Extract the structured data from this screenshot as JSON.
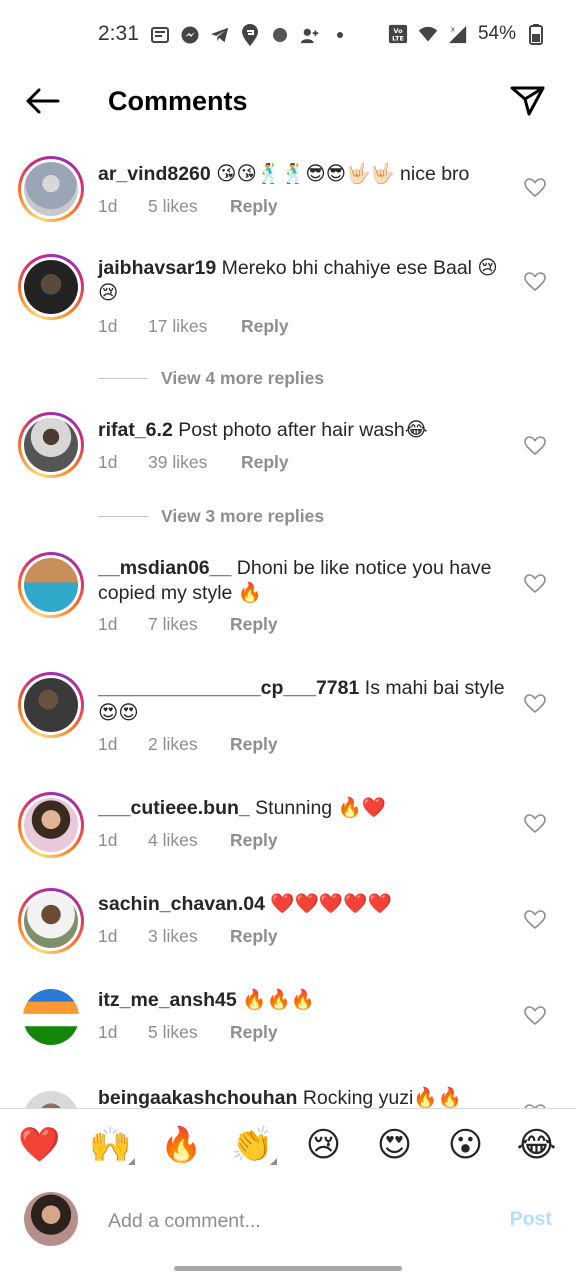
{
  "status_bar": {
    "time": "2:31",
    "network": "VoLTE",
    "battery": "54%"
  },
  "header": {
    "title": "Comments",
    "back_icon": "arrow-left-icon",
    "send_icon": "paper-plane-icon"
  },
  "comments": [
    {
      "username": "ar_vind8260",
      "text": "😘😘🕺🕺😎😎🤟🏻🤟🏻 nice bro",
      "time": "1d",
      "likes": "5 likes",
      "reply": "Reply"
    },
    {
      "username": "jaibhavsar19",
      "text": "Mereko bhi chahiye ese Baal 😢😢",
      "time": "1d",
      "likes": "17 likes",
      "reply": "Reply",
      "more_replies": "View 4 more replies"
    },
    {
      "username": "rifat_6.2",
      "text": "Post photo after hair wash😂",
      "time": "1d",
      "likes": "39 likes",
      "reply": "Reply",
      "more_replies": "View 3 more replies"
    },
    {
      "username": "__msdian06__",
      "text": "Dhoni be like notice you have copied my style 🔥",
      "time": "1d",
      "likes": "7 likes",
      "reply": "Reply"
    },
    {
      "username": "_______________cp___7781",
      "text": "Is mahi bai style 😍😍",
      "time": "1d",
      "likes": "2 likes",
      "reply": "Reply"
    },
    {
      "username": "___cutieee.bun_",
      "text": "Stunning 🔥❤️",
      "time": "1d",
      "likes": "4 likes",
      "reply": "Reply"
    },
    {
      "username": "sachin_chavan.04",
      "text": "❤️❤️❤️❤️❤️",
      "time": "1d",
      "likes": "3 likes",
      "reply": "Reply"
    },
    {
      "username": "itz_me_ansh45",
      "text": "🔥🔥🔥",
      "time": "1d",
      "likes": "5 likes",
      "reply": "Reply"
    },
    {
      "username": "beingaakashchouhan",
      "text": "Rocking yuzi🔥🔥",
      "time": "",
      "likes": "",
      "reply": ""
    }
  ],
  "quick_reactions": [
    "❤️",
    "🙌",
    "🔥",
    "👏",
    "😢",
    "😍",
    "😮",
    "😂"
  ],
  "composer": {
    "placeholder": "Add a comment...",
    "post_label": "Post"
  },
  "colors": {
    "link_disabled": "#b2dffc",
    "secondary_text": "#8e8e8e",
    "heart": "#d62976"
  }
}
